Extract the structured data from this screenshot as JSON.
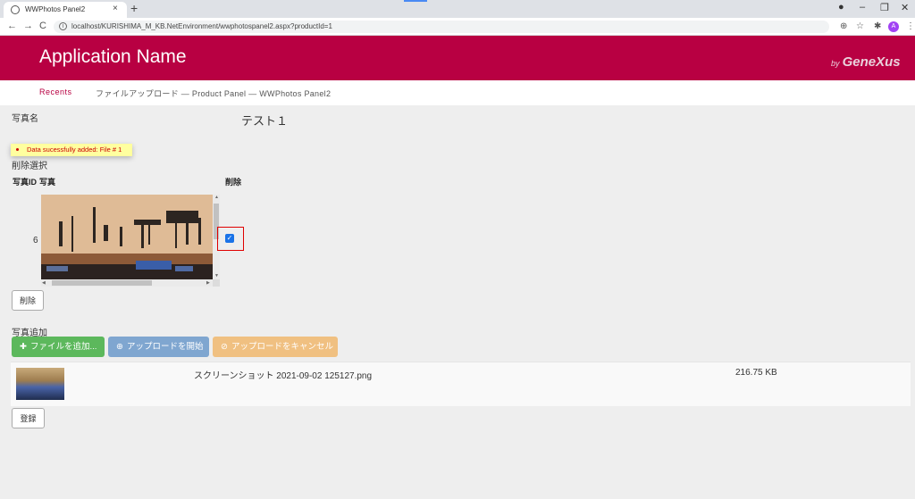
{
  "browser": {
    "tab_title": "WWPhotos Panel2",
    "tab_close": "×",
    "new_tab": "+",
    "url": "localhost/KURISHIMA_M_KB.NetEnvironment/wwphotospanel2.aspx?productId=1",
    "avatar_letter": "A"
  },
  "header": {
    "app_name": "Application Name",
    "brand_prefix": "by",
    "brand_name": "GeneXus"
  },
  "breadcrumb": {
    "recents": "Recents",
    "path": "ファイルアップロード — Product Panel — WWPhotos Panel2"
  },
  "form": {
    "photo_name_label": "写真名",
    "photo_name_value": "テスト１",
    "toast_message": "Data sucessfully added: File # 1",
    "delete_select_label": "削除選択"
  },
  "grid": {
    "columns": [
      "写真ID",
      "写真",
      "削除"
    ],
    "rows": [
      {
        "id": "6",
        "delete_checked": true
      }
    ]
  },
  "buttons": {
    "delete": "削除",
    "add_file": "ファイルを追加...",
    "start_upload": "アップロードを開始",
    "cancel_upload": "アップロードをキャンセル",
    "register": "登録"
  },
  "upload": {
    "section_label": "写真追加",
    "files": [
      {
        "name": "スクリーンショット 2021-09-02 125127.png",
        "size": "216.75 KB"
      }
    ]
  },
  "colors": {
    "brand": "#b80042",
    "add_button": "#5cb85c",
    "start_button": "#7fa6d0",
    "cancel_button": "#f0c081",
    "highlight": "#e00000"
  }
}
